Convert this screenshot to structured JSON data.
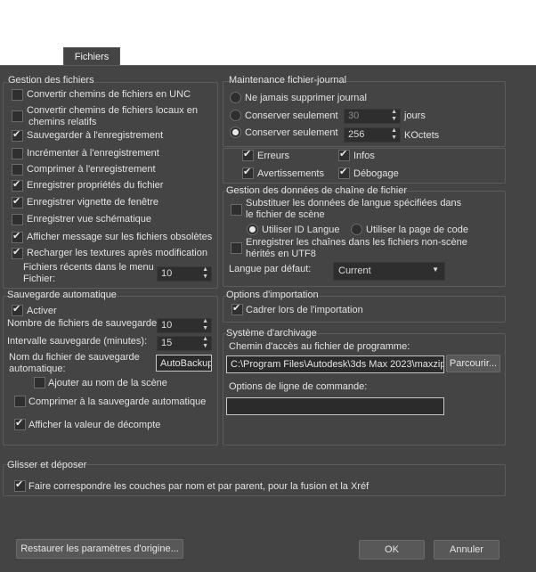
{
  "tab": {
    "label": "Fichiers"
  },
  "gestion": {
    "title": "Gestion des fichiers",
    "items": [
      {
        "label": "Convertir chemins de fichiers en UNC",
        "checked": false
      },
      {
        "label": "Convertir chemins de fichiers locaux en",
        "label2": "chemins relatifs",
        "checked": false
      },
      {
        "label": "Sauvegarder à l'enregistrement",
        "checked": true
      },
      {
        "label": "Incrémenter à l'enregistrement",
        "checked": false
      },
      {
        "label": "Comprimer à l'enregistrement",
        "checked": false
      },
      {
        "label": "Enregistrer propriétés du fichier",
        "checked": true
      },
      {
        "label": "Enregistrer vignette de fenêtre",
        "checked": true
      },
      {
        "label": "Enregistrer vue schématique",
        "checked": false
      },
      {
        "label": "Afficher message sur les fichiers obsolètes",
        "checked": true
      },
      {
        "label": "Recharger les textures après modification",
        "checked": true
      }
    ],
    "recent_label1": "Fichiers récents dans le menu",
    "recent_label2": "Fichier:",
    "recent_value": "10"
  },
  "autosave": {
    "title": "Sauvegarde automatique",
    "enable_label": "Activer",
    "count_label": "Nombre de fichiers de sauvegarde:",
    "count_value": "10",
    "interval_label": "Intervalle sauvegarde (minutes):",
    "interval_value": "15",
    "name_label1": "Nom du fichier de sauvegarde",
    "name_label2": "automatique:",
    "name_value": "AutoBackup",
    "append_label": "Ajouter au nom de la scène",
    "compress_label": "Comprimer à la sauvegarde automatique",
    "countdown_label": "Afficher la valeur de décompte"
  },
  "journal": {
    "title": "Maintenance fichier-journal",
    "never_label": "Ne jamais supprimer journal",
    "keep_days_label": "Conserver seulement",
    "days_value": "30",
    "days_unit": "jours",
    "keep_kb_label": "Conserver seulement",
    "kb_value": "256",
    "kb_unit": "KOctets",
    "errors_label": "Erreurs",
    "infos_label": "Infos",
    "warnings_label": "Avertissements",
    "debug_label": "Débogage"
  },
  "strings": {
    "title": "Gestion des données de chaîne de fichier",
    "override_label1": "Substituer les données de langue spécifiées dans",
    "override_label2": "le fichier de scène",
    "use_lang_id": "Utiliser ID Langue",
    "use_codepage": "Utiliser la page de code",
    "save_utf8_1": "Enregistrer les chaînes dans les fichiers non-scène",
    "save_utf8_2": "hérités en UTF8",
    "default_lang_label": "Langue par défaut:",
    "default_lang_value": "Current"
  },
  "import": {
    "title": "Options d'importation",
    "zoom_label": "Cadrer lors de l'importation"
  },
  "archive": {
    "title": "Système d'archivage",
    "path_label": "Chemin d'accès au fichier de programme:",
    "path_value": "C:\\Program Files\\Autodesk\\3ds Max 2023\\maxzip",
    "browse_label": "Parcourir...",
    "cmd_label": "Options de ligne de commande:",
    "cmd_value": ""
  },
  "drag": {
    "title": "Glisser et déposer",
    "match_label": "Faire correspondre les couches par nom et par parent, pour la fusion et la Xréf"
  },
  "footer": {
    "restore_label": "Restaurer les paramètres d'origine...",
    "ok_label": "OK",
    "cancel_label": "Annuler"
  },
  "colors": {
    "panel": "#444444",
    "field": "#2e2e2e",
    "text": "#e2e2e2"
  }
}
